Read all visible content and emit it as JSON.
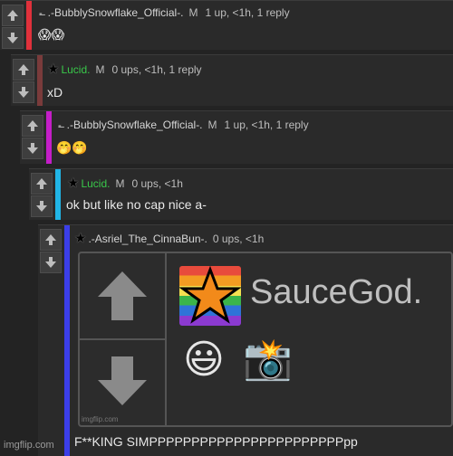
{
  "colors": {
    "background": "#232323",
    "panel": "#2a2a2a",
    "bar_red": "#e0313b",
    "bar_brown": "#7a3b3b",
    "bar_magenta": "#c41ec8",
    "bar_cyan": "#21b5e6",
    "bar_blue": "#3b3ee8",
    "username_green": "#39c84a"
  },
  "comments": [
    {
      "username": ".-BubblySnowflake_Official-.",
      "badge": "M",
      "stats": "1 up, <1h, 1 reply",
      "body": "😱😱"
    },
    {
      "username": "Lucid.",
      "badge": "M",
      "stats": "0 ups, <1h, 1 reply",
      "body": "xD"
    },
    {
      "username": ".-BubblySnowflake_Official-.",
      "badge": "M",
      "stats": "1 up, <1h, 1 reply",
      "body": "🤭🤭"
    },
    {
      "username": "Lucid.",
      "badge": "M",
      "stats": "0 ups, <1h",
      "body": "ok but like no cap nice a-"
    },
    {
      "username": ".-Asriel_The_CinnaBun-.",
      "stats": "0 ups, <1h",
      "body": "F**KING SIMPPPPPPPPPPPPPPPPPPPPPPPpp"
    }
  ],
  "meme": {
    "title": "SauceGod.",
    "emoji_smile": "😃",
    "emoji_camera": "📸",
    "emoji_star": "⭐",
    "small_watermark": "imgflip.com"
  },
  "small_mark": "-̶",
  "watermark": "imgflip.com"
}
